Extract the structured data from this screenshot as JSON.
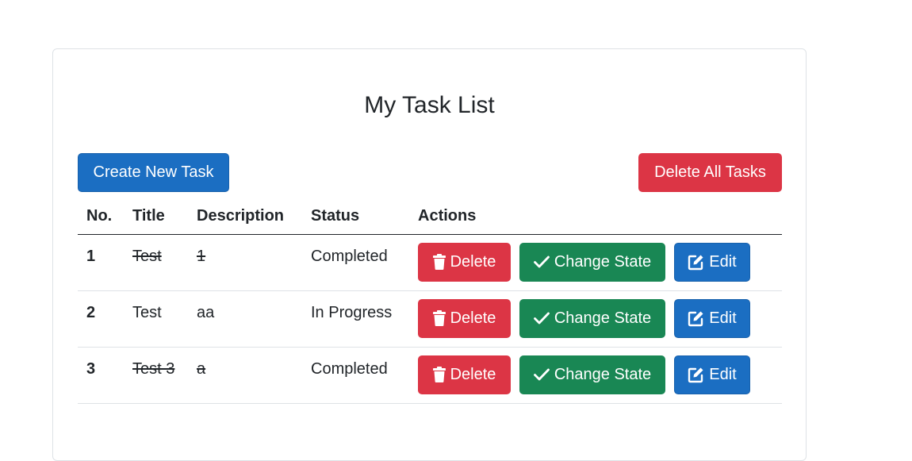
{
  "title": "My Task List",
  "toolbar": {
    "create_label": "Create New Task",
    "delete_all_label": "Delete All Tasks"
  },
  "columns": [
    "No.",
    "Title",
    "Description",
    "Status",
    "Actions"
  ],
  "tasks": [
    {
      "no": "1",
      "title": "Test",
      "description": "1",
      "status": "Completed",
      "struck": true
    },
    {
      "no": "2",
      "title": "Test",
      "description": "aa",
      "status": "In Progress",
      "struck": false
    },
    {
      "no": "3",
      "title": "Test 3",
      "description": "a",
      "status": "Completed",
      "struck": true
    }
  ],
  "actions": {
    "delete_label": "Delete",
    "change_state_label": "Change State",
    "edit_label": "Edit"
  },
  "icons": {
    "delete": "trash-icon",
    "change_state": "check-icon",
    "edit": "edit-icon"
  },
  "colors": {
    "primary": "#1b6ec2",
    "danger": "#dc3545",
    "success": "#198754"
  }
}
